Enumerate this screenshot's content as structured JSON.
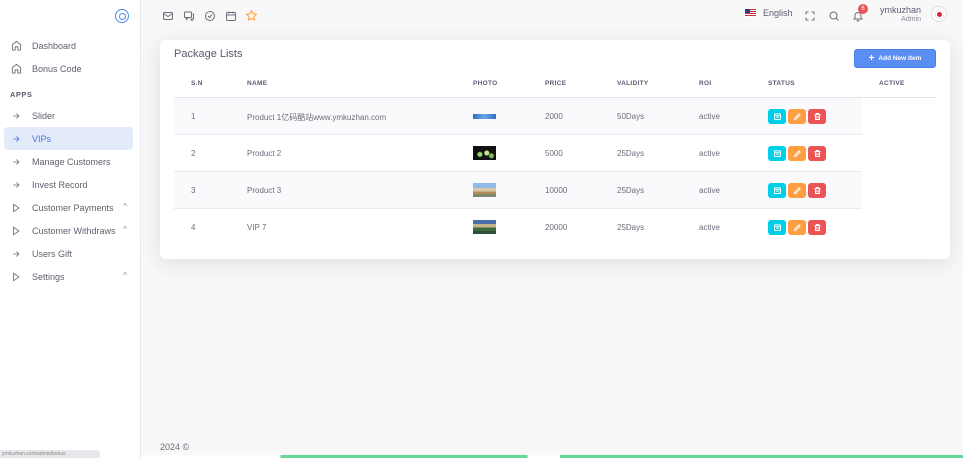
{
  "sidebar": {
    "items_top": [
      {
        "label": "Dashboard",
        "icon": "home-icon"
      },
      {
        "label": "Bonus Code",
        "icon": "home-icon"
      }
    ],
    "section_label": "APPS",
    "items_apps": [
      {
        "label": "Slider",
        "icon": "arrow-right-icon"
      },
      {
        "label": "VIPs",
        "icon": "arrow-right-icon",
        "active": true
      },
      {
        "label": "Manage Customers",
        "icon": "arrow-right-icon"
      },
      {
        "label": "Invest Record",
        "icon": "arrow-right-icon"
      },
      {
        "label": "Customer Payments",
        "icon": "play-icon",
        "expandable": true
      },
      {
        "label": "Customer Withdraws",
        "icon": "play-icon",
        "expandable": true
      },
      {
        "label": "Users Gift",
        "icon": "arrow-right-icon"
      },
      {
        "label": "Settings",
        "icon": "play-icon",
        "expandable": true
      }
    ],
    "status_url": "ymkuzhan.com/admin/bonus"
  },
  "topbar": {
    "shortcut_icons": [
      "mail-icon",
      "chat-icon",
      "check-circle-icon",
      "calendar-icon",
      "star-icon"
    ],
    "language": "English",
    "notification_count": "6",
    "user_name": "ymkuzhan",
    "user_role": "Admin"
  },
  "card": {
    "title": "Package Lists",
    "add_button": "Add New Item",
    "headers": [
      "S.N",
      "NAME",
      "PHOTO",
      "PRICE",
      "VALIDITY",
      "ROI",
      "STATUS",
      "ACTIVE"
    ],
    "rows": [
      {
        "sn": "1",
        "name": "Product 1亿码酷站www.ymkuzhan.com",
        "price": "2000",
        "validity": "50Days",
        "roi": "active"
      },
      {
        "sn": "2",
        "name": "Product 2",
        "price": "5000",
        "validity": "25Days",
        "roi": "active"
      },
      {
        "sn": "3",
        "name": "Product 3",
        "price": "10000",
        "validity": "25Days",
        "roi": "active"
      },
      {
        "sn": "4",
        "name": "VIP 7",
        "price": "20000",
        "validity": "25Days",
        "roi": "active"
      }
    ]
  },
  "footer": {
    "copyright": "2024 ©"
  },
  "colors": {
    "accent": "#5a8ef5",
    "view": "#00cfe8",
    "edit": "#ff9f43",
    "delete": "#ea5455"
  }
}
